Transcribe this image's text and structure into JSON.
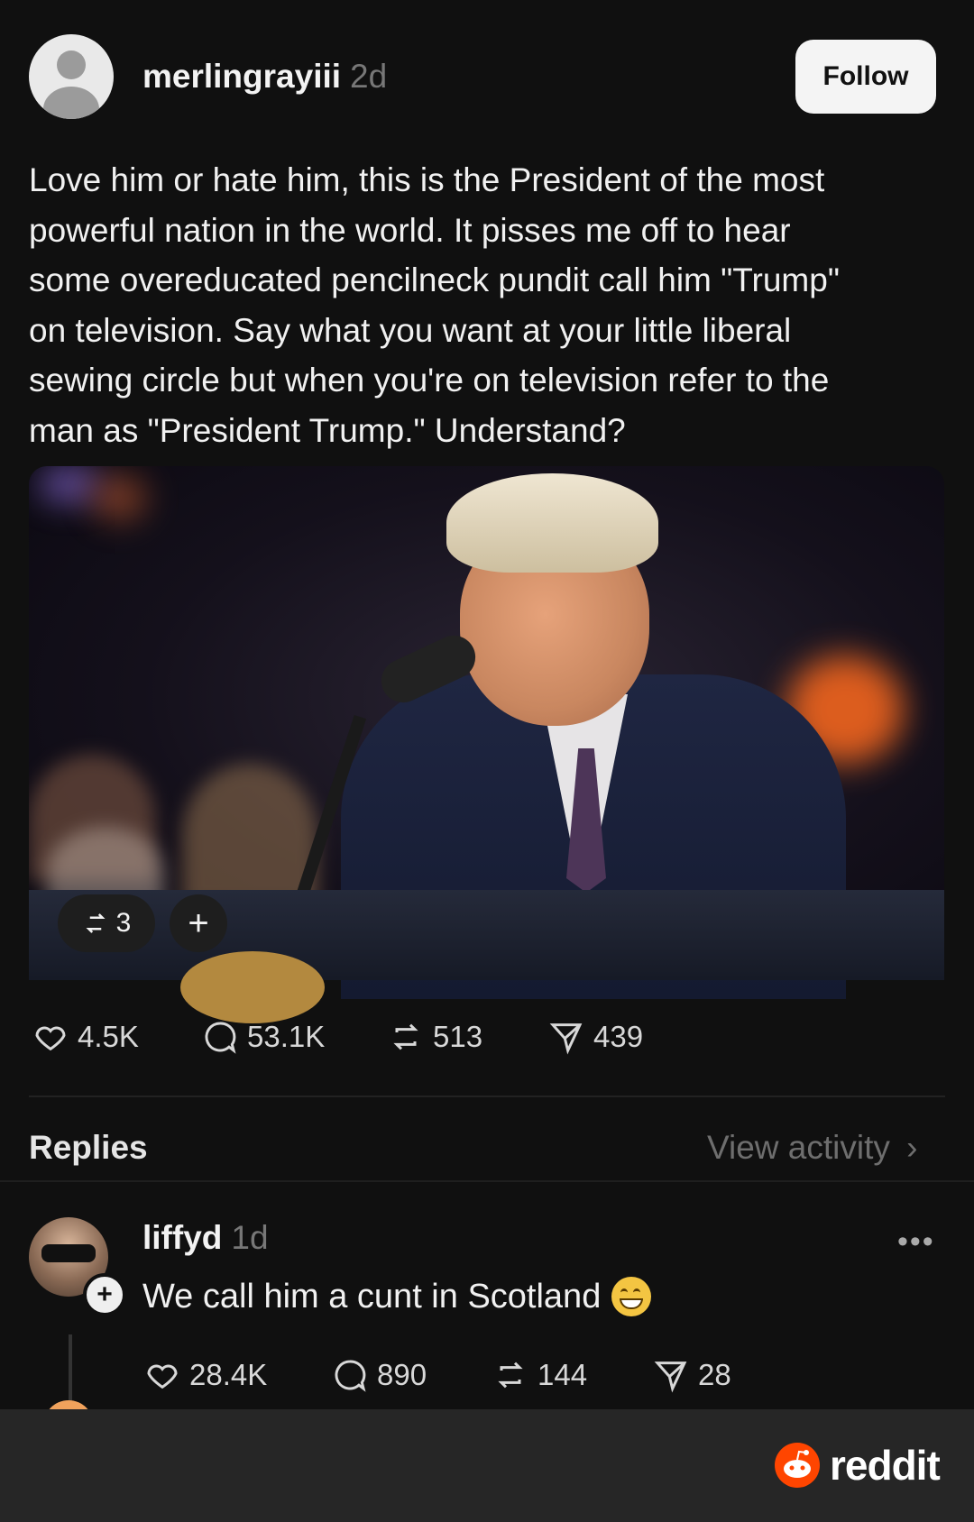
{
  "post": {
    "author": "merlingrayiii",
    "time": "2d",
    "follow_label": "Follow",
    "text_lines": [
      "Love him or hate him, this is the President of the most",
      "powerful nation in the world. It pisses me off to hear",
      "some overeducated pencilneck pundit call him \"Trump\"",
      "on television.  Say what you want at your little liberal",
      "sewing circle but when you're on television refer to the",
      "man as \"President Trump.\" Understand?"
    ],
    "image": {
      "repost_count": "3",
      "add_label": "+"
    },
    "actions": {
      "likes": "4.5K",
      "comments": "53.1K",
      "reposts": "513",
      "shares": "439"
    }
  },
  "replies_header": {
    "title": "Replies",
    "view_activity": "View activity",
    "chevron": "›"
  },
  "reply": {
    "author": "liffyd",
    "time": "1d",
    "more": "•••",
    "text": "We call him a cunt in Scotland",
    "emoji_icon": "grinning-face-icon",
    "actions": {
      "likes": "28.4K",
      "comments": "890",
      "reposts": "144",
      "shares": "28"
    }
  },
  "watermark": {
    "brand": "reddit",
    "color": "#ff4500"
  }
}
